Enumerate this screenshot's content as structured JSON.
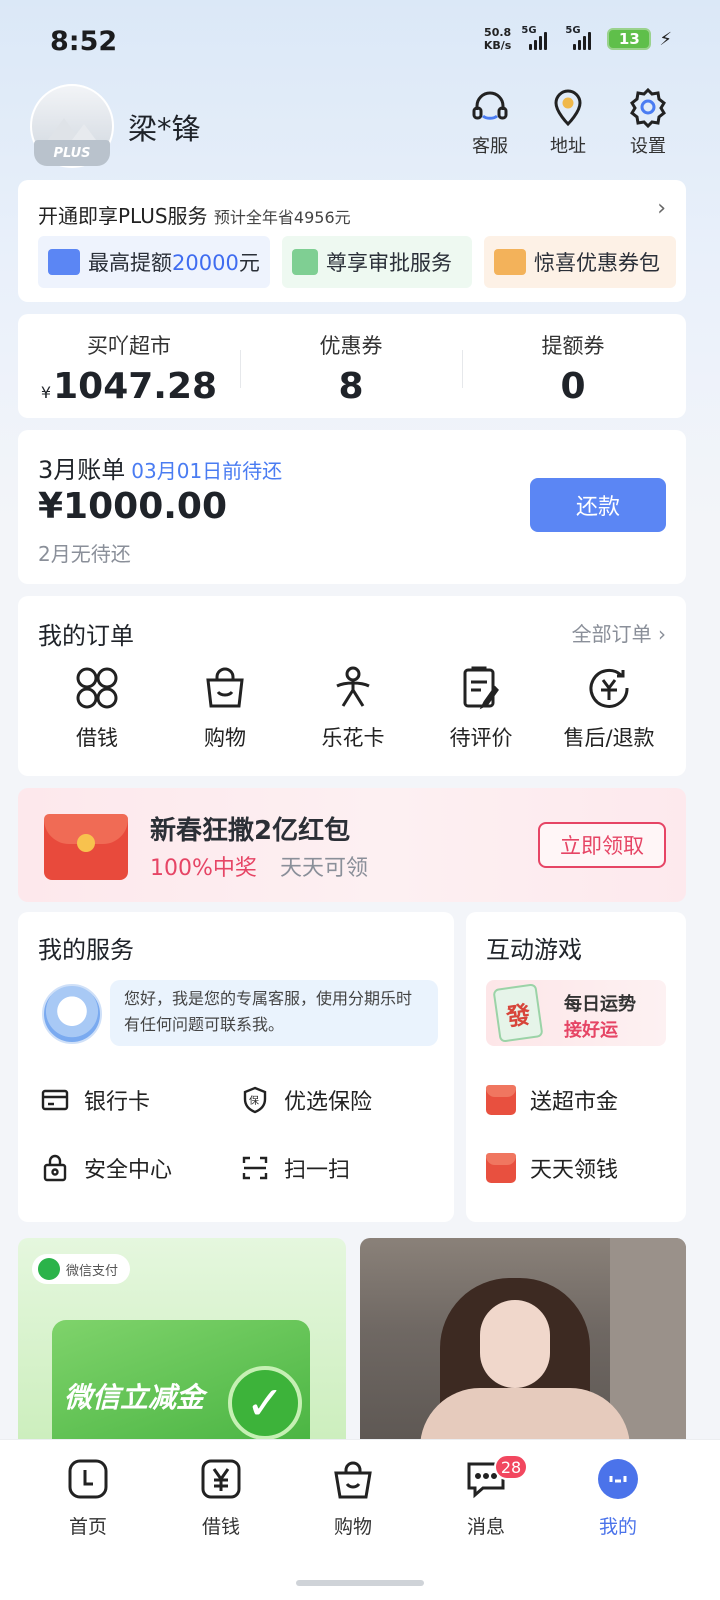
{
  "status_bar": {
    "time": "8:52",
    "net_speed_value": "50.8",
    "net_speed_unit": "KB/s",
    "sim1": "5G",
    "sim2": "5G",
    "battery": "13"
  },
  "profile": {
    "username": "梁*锋",
    "badge": "PLUS"
  },
  "header_actions": [
    {
      "label": "客服",
      "icon": "headset-icon"
    },
    {
      "label": "地址",
      "icon": "location-pin-icon"
    },
    {
      "label": "设置",
      "icon": "gear-icon"
    }
  ],
  "plus_card": {
    "title": "开通即享PLUS服务",
    "subtitle": "预计全年省4956元",
    "perks": [
      {
        "prefix": "最高提额",
        "highlight": "20000",
        "suffix": "元",
        "color": "#eef3fd"
      },
      {
        "prefix": "尊享审批服务",
        "highlight": "",
        "suffix": "",
        "color": "#eef9f1"
      },
      {
        "prefix": "惊喜优惠券包",
        "highlight": "",
        "suffix": "",
        "color": "#fdf1e6"
      }
    ]
  },
  "stats": [
    {
      "label": "买吖超市",
      "currency": "¥",
      "value": "1047.28"
    },
    {
      "label": "优惠券",
      "currency": "",
      "value": "8"
    },
    {
      "label": "提额券",
      "currency": "",
      "value": "0"
    }
  ],
  "bill": {
    "title": "3月账单",
    "due": "03月01日前待还",
    "amount": "¥1000.00",
    "note": "2月无待还",
    "button": "还款"
  },
  "orders": {
    "title": "我的订单",
    "see_all": "全部订单 ›",
    "items": [
      {
        "label": "借钱",
        "icon": "four-petal-icon"
      },
      {
        "label": "购物",
        "icon": "shopping-bag-icon"
      },
      {
        "label": "乐花卡",
        "icon": "flower-card-icon"
      },
      {
        "label": "待评价",
        "icon": "clipboard-edit-icon"
      },
      {
        "label": "售后/退款",
        "icon": "refund-icon"
      }
    ]
  },
  "banner": {
    "title": "新春狂撒2亿红包",
    "sub_highlight": "100%中奖",
    "sub_text": "天天可领",
    "button": "立即领取"
  },
  "services": {
    "title": "我的服务",
    "bot_message": "您好，我是您的专属客服，使用分期乐时有任何问题可联系我。",
    "items": [
      {
        "label": "银行卡",
        "icon": "bank-card-icon"
      },
      {
        "label": "优选保险",
        "icon": "shield-bao-icon"
      },
      {
        "label": "安全中心",
        "icon": "lock-icon"
      },
      {
        "label": "扫一扫",
        "icon": "scan-icon"
      }
    ]
  },
  "games": {
    "title": "互动游戏",
    "banner_tile": "發",
    "banner_line1": "每日运势",
    "banner_line2": "接好运",
    "items": [
      {
        "label": "送超市金",
        "icon": "red-envelope-icon"
      },
      {
        "label": "天天领钱",
        "icon": "red-envelope-icon"
      }
    ]
  },
  "feed": {
    "left_tag": "微信支付",
    "left_title": "微信立减金"
  },
  "bottom_nav": [
    {
      "label": "首页",
      "icon": "home-clock-icon",
      "active": false
    },
    {
      "label": "借钱",
      "icon": "yen-icon",
      "active": false
    },
    {
      "label": "购物",
      "icon": "bag-icon",
      "active": false
    },
    {
      "label": "消息",
      "icon": "chat-icon",
      "active": false,
      "badge": "28"
    },
    {
      "label": "我的",
      "icon": "profile-dot-icon",
      "active": true
    }
  ]
}
